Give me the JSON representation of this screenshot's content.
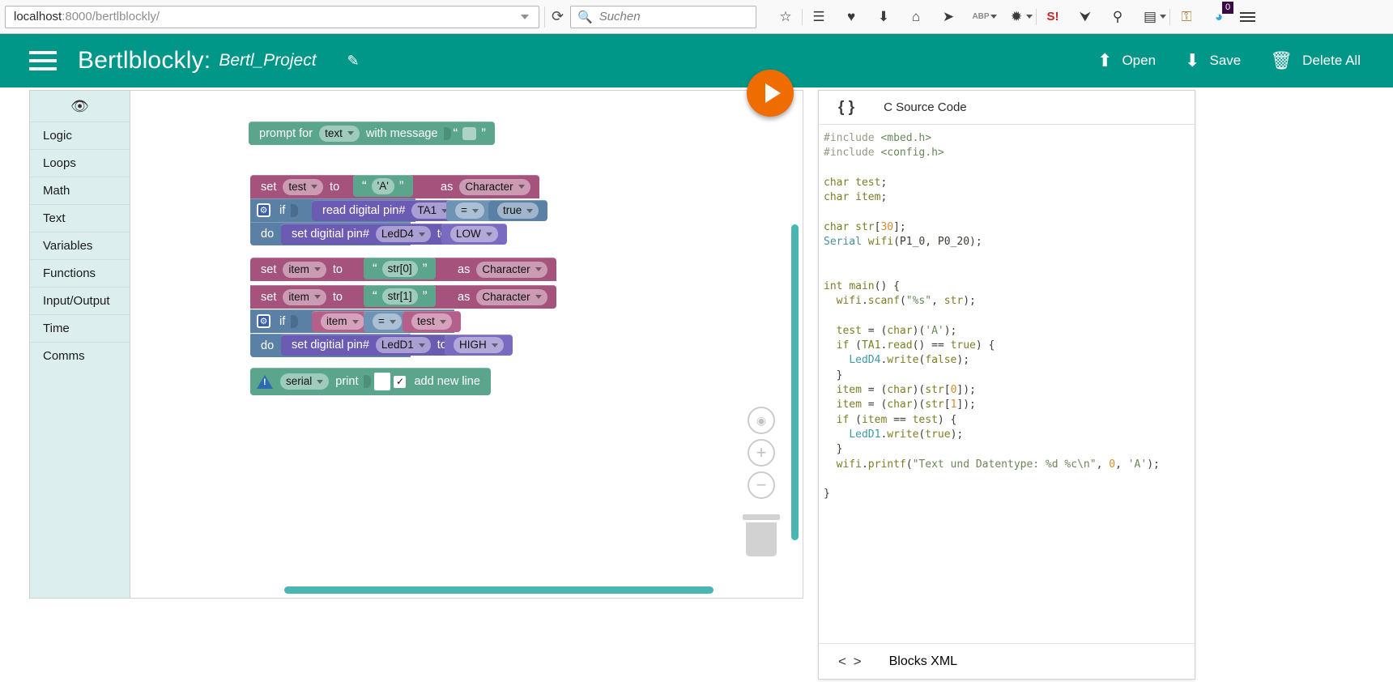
{
  "browser": {
    "url_prefix": "localhost",
    "url_rest": ":8000/bertlblockly/",
    "search_placeholder": "Suchen",
    "reload_icon": "reload-icon",
    "toolbar_icons": [
      {
        "name": "bookmark-star-icon",
        "glyph": "☆"
      },
      {
        "name": "reader-list-icon",
        "glyph": "☰"
      },
      {
        "name": "pocket-shield-icon",
        "glyph": "♥"
      },
      {
        "name": "downloads-icon",
        "glyph": "⬇"
      },
      {
        "name": "home-icon",
        "glyph": "⌂"
      },
      {
        "name": "send-paperplane-icon",
        "glyph": "➤"
      },
      {
        "name": "adblockplus-icon",
        "glyph": "ABP"
      },
      {
        "name": "spider-icon",
        "glyph": "✹"
      },
      {
        "name": "shodan-icon",
        "glyph": "S!"
      },
      {
        "name": "drop-icon",
        "glyph": "⮟"
      },
      {
        "name": "magnifier-icon",
        "glyph": "⚲"
      },
      {
        "name": "server-icon",
        "glyph": "▤"
      },
      {
        "name": "lock-icon",
        "glyph": "⚿"
      },
      {
        "name": "ghost-icon",
        "glyph": "◕"
      }
    ],
    "badge_value": "0"
  },
  "header": {
    "menu_icon": "hamburger-menu-icon",
    "title": "Bertlblockly:",
    "project_name": "Bertl_Project",
    "edit_icon": "pencil-edit-icon",
    "actions": [
      {
        "name": "open-button",
        "icon": "upload-icon",
        "glyph": "⬆",
        "label": "Open"
      },
      {
        "name": "save-button",
        "icon": "download-icon",
        "glyph": "⬇",
        "label": "Save"
      },
      {
        "name": "delete-all-button",
        "icon": "trash-icon",
        "glyph": "🗑",
        "label": "Delete All"
      }
    ]
  },
  "toolbox": {
    "hide_icon": "eye-slash-icon",
    "categories": [
      {
        "label": "Logic"
      },
      {
        "label": "Loops"
      },
      {
        "label": "Math"
      },
      {
        "label": "Text"
      },
      {
        "label": "Variables"
      },
      {
        "label": "Functions"
      },
      {
        "label": "Input/Output"
      },
      {
        "label": "Time"
      },
      {
        "label": "Comms"
      }
    ]
  },
  "canvas": {
    "run_button_icon": "play-triangle-icon",
    "zoom_center_icon": "zoom-center-icon",
    "zoom_in_icon": "zoom-in-icon",
    "zoom_out_icon": "zoom-out-icon",
    "trash_icon": "trash-can-icon",
    "blocks": {
      "prompt": {
        "label_a": "prompt for",
        "field_type": "text",
        "label_b": "with message",
        "quote_open": "“",
        "quote_close": "”"
      },
      "set_test": {
        "label_set": "set",
        "var": "test",
        "label_to": "to",
        "quote_open": "“",
        "value": "'A'",
        "quote_close": "”",
        "label_as": "as",
        "cast": "Character"
      },
      "if_ta1": {
        "label_if": "if",
        "read_label": "read digital pin#",
        "pin": "TA1",
        "op": "=",
        "bool": "true",
        "label_do": "do",
        "set_label": "set digitial pin#",
        "out_pin": "LedD4",
        "label_to": "to",
        "out_value": "LOW"
      },
      "set_item_0": {
        "label_set": "set",
        "var": "item",
        "label_to": "to",
        "quote_open": "“",
        "value": "str[0]",
        "quote_close": "”",
        "label_as": "as",
        "cast": "Character"
      },
      "set_item_1": {
        "label_set": "set",
        "var": "item",
        "label_to": "to",
        "quote_open": "“",
        "value": "str[1]",
        "quote_close": "”",
        "label_as": "as",
        "cast": "Character"
      },
      "if_item": {
        "label_if": "if",
        "left": "item",
        "op": "=",
        "right": "test",
        "label_do": "do",
        "set_label": "set digitial pin#",
        "out_pin": "LedD1",
        "label_to": "to",
        "out_value": "HIGH"
      },
      "serial_print": {
        "warn_icon": "warning-triangle-icon",
        "port": "serial",
        "label_print": "print",
        "checkbox": "✓",
        "label_newline": "add new line"
      }
    }
  },
  "code_panel": {
    "header_icon": "braces-icon",
    "header_icon_glyph": "{ }",
    "header_title": "C Source Code",
    "footer_icon": "angle-brackets-icon",
    "footer_icon_glyph": "< >",
    "footer_title": "Blocks XML",
    "source_lines": [
      "#include <mbed.h>",
      "#include <config.h>",
      "",
      "char test;",
      "char item;",
      "",
      "char str[30];",
      "Serial wifi(P1_0, P0_20);",
      "",
      "",
      "int main() {",
      "  wifi.scanf(\"%s\", str);",
      "",
      "  test = (char)('A');",
      "  if (TA1.read() == true) {",
      "    LedD4.write(false);",
      "  }",
      "  item = (char)(str[0]);",
      "  item = (char)(str[1]);",
      "  if (item == test) {",
      "    LedD1.write(true);",
      "  }",
      "  wifi.printf(\"Text und Datentype: %d %c\\n\", 0, 'A');",
      "",
      "}"
    ]
  },
  "colors": {
    "app_header": "#009688",
    "run_button": "#ef6c00",
    "toolbox_bg": "#ddeeee",
    "scrollbar": "#4bb5b2",
    "text_block": "#5ba58c",
    "variable_block": "#a5527c",
    "logic_block": "#5b80a5",
    "io_block": "#6b5bb3"
  }
}
